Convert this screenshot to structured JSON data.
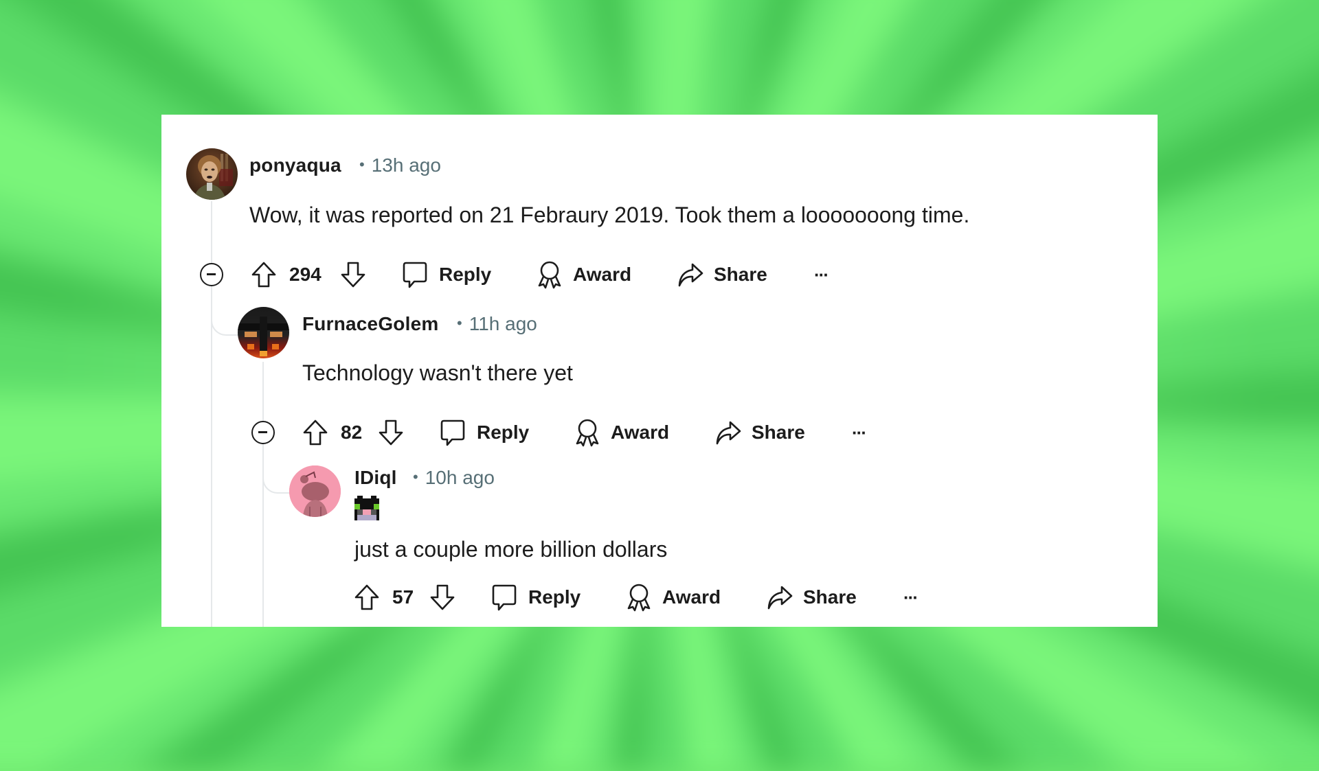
{
  "colors": {
    "text": "#1c1c1c",
    "meta": "#576f76",
    "thread_line": "#e5e8ea",
    "card_bg": "#ffffff",
    "background_light": "#7af57a",
    "background_dark": "#3db54a",
    "avatar_pink": "#f59aaf"
  },
  "comments": [
    {
      "username": "ponyaqua",
      "separator": "•",
      "timestamp": "13h ago",
      "text": "Wow, it was reported on 21 Febraury 2019. Took them a looooooong time.",
      "score": "294",
      "collapsible": true,
      "actions": {
        "reply": "Reply",
        "award": "Award",
        "share": "Share",
        "more": "···"
      },
      "icons": [
        "collapse-icon",
        "upvote-icon",
        "downvote-icon",
        "comment-bubble-icon",
        "award-ribbon-icon",
        "share-arrow-icon",
        "more-dots-icon"
      ]
    },
    {
      "username": "FurnaceGolem",
      "separator": "•",
      "timestamp": "11h ago",
      "text": "Technology wasn't there yet",
      "score": "82",
      "collapsible": true,
      "actions": {
        "reply": "Reply",
        "award": "Award",
        "share": "Share",
        "more": "···"
      }
    },
    {
      "username": "IDiql",
      "separator": "•",
      "timestamp": "10h ago",
      "flair": "pixel-cat-flair",
      "text": "just a couple more billion dollars",
      "score": "57",
      "collapsible": false,
      "actions": {
        "reply": "Reply",
        "award": "Award",
        "share": "Share",
        "more": "···"
      }
    }
  ]
}
